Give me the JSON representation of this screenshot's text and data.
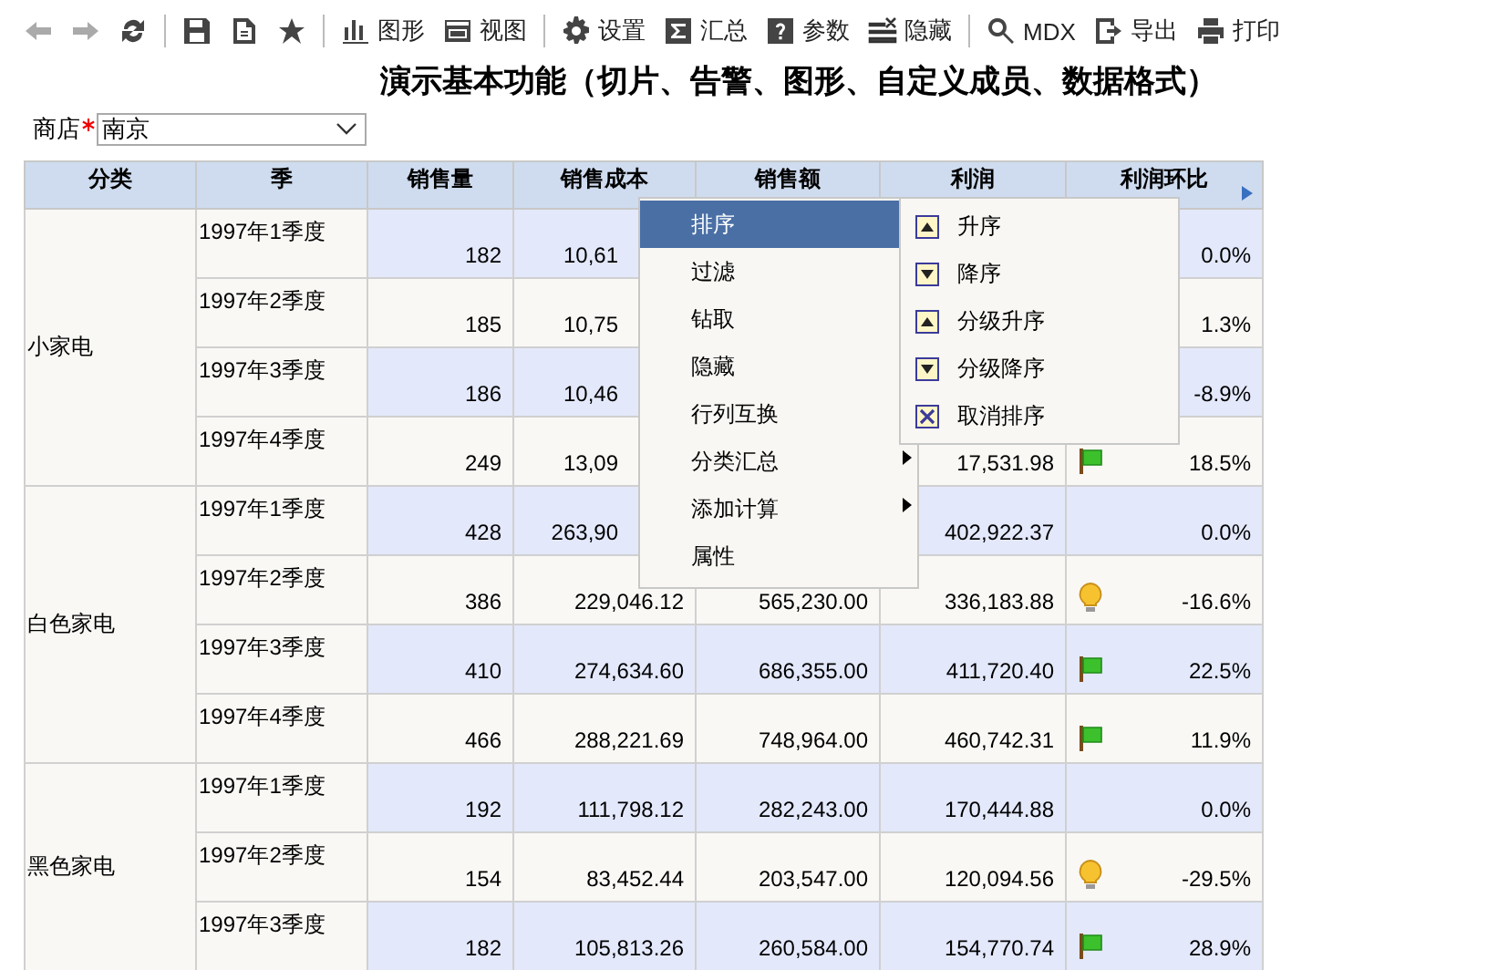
{
  "toolbar": [
    {
      "kind": "back",
      "disabled": true
    },
    {
      "kind": "forward",
      "disabled": true
    },
    {
      "kind": "refresh",
      "disabled": false
    },
    {
      "kind": "save",
      "disabled": false,
      "separator_before": true
    },
    {
      "kind": "save-as",
      "disabled": false
    },
    {
      "kind": "star",
      "disabled": false
    },
    {
      "kind": "chart",
      "label": "图形",
      "disabled": false,
      "separator_before": true
    },
    {
      "kind": "view",
      "label": "视图",
      "disabled": false
    },
    {
      "kind": "settings",
      "label": "设置",
      "disabled": false,
      "separator_before": true
    },
    {
      "kind": "sum",
      "label": "汇总",
      "disabled": false
    },
    {
      "kind": "param",
      "label": "参数",
      "disabled": false
    },
    {
      "kind": "hide",
      "label": "隐藏",
      "disabled": false
    },
    {
      "kind": "search",
      "label": "MDX",
      "disabled": false,
      "separator_before": true
    },
    {
      "kind": "export",
      "label": "导出",
      "disabled": false
    },
    {
      "kind": "print",
      "label": "打印",
      "disabled": false
    }
  ],
  "title": "演示基本功能（切片、告警、图形、自定义成员、数据格式）",
  "filter": {
    "label": "商店",
    "required": true,
    "value": "南京"
  },
  "table": {
    "columns": [
      "分类",
      "季",
      "销售量",
      "销售成本",
      "销售额",
      "利润",
      "利润环比"
    ],
    "groups": [
      {
        "name": "小家电",
        "rows": [
          {
            "quarter": "1997年1季度",
            "qty": "182",
            "cost": "10,61",
            "cost_partial": true,
            "ratio": "0.0%"
          },
          {
            "quarter": "1997年2季度",
            "qty": "185",
            "cost": "10,75",
            "cost_partial": true,
            "ratio": "1.3%"
          },
          {
            "quarter": "1997年3季度",
            "qty": "186",
            "cost": "10,46",
            "cost_partial": true,
            "ratio": "-8.9%"
          },
          {
            "quarter": "1997年4季度",
            "qty": "249",
            "cost": "13,09",
            "cost_partial": true,
            "profit": "17,531.98",
            "indicator": {
              "kind": "flag"
            },
            "ratio": "18.5%"
          }
        ]
      },
      {
        "name": "白色家电",
        "rows": [
          {
            "quarter": "1997年1季度",
            "qty": "428",
            "cost": "263,90",
            "cost_partial": true,
            "profit": "402,922.37",
            "ratio": "0.0%"
          },
          {
            "quarter": "1997年2季度",
            "qty": "386",
            "cost": "229,046.12",
            "sales": "565,230.00",
            "profit": "336,183.88",
            "indicator": {
              "kind": "bulb"
            },
            "ratio": "-16.6%"
          },
          {
            "quarter": "1997年3季度",
            "qty": "410",
            "cost": "274,634.60",
            "sales": "686,355.00",
            "profit": "411,720.40",
            "indicator": {
              "kind": "flag"
            },
            "ratio": "22.5%"
          },
          {
            "quarter": "1997年4季度",
            "qty": "466",
            "cost": "288,221.69",
            "sales": "748,964.00",
            "profit": "460,742.31",
            "indicator": {
              "kind": "flag"
            },
            "ratio": "11.9%"
          }
        ]
      },
      {
        "name": "黑色家电",
        "rows": [
          {
            "quarter": "1997年1季度",
            "qty": "192",
            "cost": "111,798.12",
            "sales": "282,243.00",
            "profit": "170,444.88",
            "ratio": "0.0%"
          },
          {
            "quarter": "1997年2季度",
            "qty": "154",
            "cost": "83,452.44",
            "sales": "203,547.00",
            "profit": "120,094.56",
            "indicator": {
              "kind": "bulb"
            },
            "ratio": "-29.5%"
          },
          {
            "quarter": "1997年3季度",
            "qty": "182",
            "cost": "105,813.26",
            "sales": "260,584.00",
            "profit": "154,770.74",
            "indicator": {
              "kind": "flag"
            },
            "ratio": "28.9%"
          }
        ]
      }
    ]
  },
  "context_menu": {
    "items": [
      {
        "label": "排序",
        "selected": true,
        "submenu": false
      },
      {
        "label": "过滤",
        "selected": false,
        "submenu": false
      },
      {
        "label": "钻取",
        "selected": false,
        "submenu": false
      },
      {
        "label": "隐藏",
        "selected": false,
        "submenu": false
      },
      {
        "label": "行列互换",
        "selected": false,
        "submenu": false
      },
      {
        "label": "分类汇总",
        "selected": false,
        "submenu": true
      },
      {
        "label": "添加计算",
        "selected": false,
        "submenu": true
      },
      {
        "label": "属性",
        "selected": false,
        "submenu": false
      }
    ],
    "submenu": [
      {
        "kind": "asc",
        "label": "升序"
      },
      {
        "kind": "desc",
        "label": "降序"
      },
      {
        "kind": "asc",
        "label": "分级升序"
      },
      {
        "kind": "desc",
        "label": "分级降序"
      },
      {
        "kind": "cancel",
        "label": "取消排序"
      }
    ]
  }
}
